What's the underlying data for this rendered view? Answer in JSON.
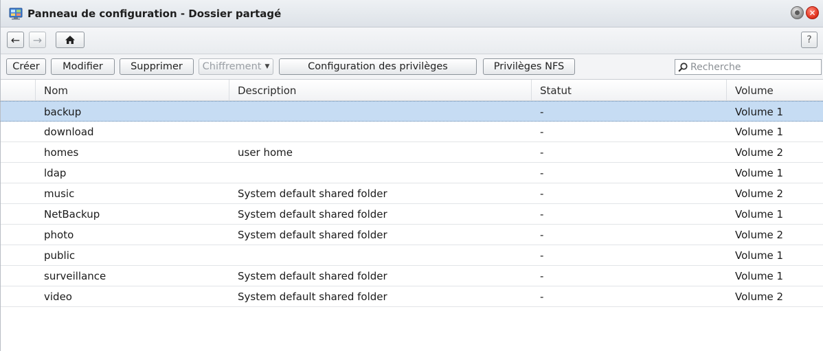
{
  "window": {
    "title": "Panneau de configuration - Dossier partagé"
  },
  "nav": {
    "back": "←",
    "forward": "→",
    "help": "?"
  },
  "toolbar": {
    "create": "Créer",
    "edit": "Modifier",
    "delete": "Supprimer",
    "encryption": "Chiffrement",
    "privileges": "Configuration des privilèges",
    "nfs": "Privilèges NFS",
    "search_placeholder": "Recherche"
  },
  "table": {
    "columns": [
      "Nom",
      "Description",
      "Statut",
      "Volume"
    ],
    "rows": [
      {
        "name": "backup",
        "description": "",
        "status": "-",
        "volume": "Volume 1",
        "selected": true
      },
      {
        "name": "download",
        "description": "",
        "status": "-",
        "volume": "Volume 1"
      },
      {
        "name": "homes",
        "description": "user home",
        "status": "-",
        "volume": "Volume 2"
      },
      {
        "name": "ldap",
        "description": "",
        "status": "-",
        "volume": "Volume 1"
      },
      {
        "name": "music",
        "description": "System default shared folder",
        "status": "-",
        "volume": "Volume 2"
      },
      {
        "name": "NetBackup",
        "description": "System default shared folder",
        "status": "-",
        "volume": "Volume 1"
      },
      {
        "name": "photo",
        "description": "System default shared folder",
        "status": "-",
        "volume": "Volume 2"
      },
      {
        "name": "public",
        "description": "",
        "status": "-",
        "volume": "Volume 1"
      },
      {
        "name": "surveillance",
        "description": "System default shared folder",
        "status": "-",
        "volume": "Volume 1"
      },
      {
        "name": "video",
        "description": "System default shared folder",
        "status": "-",
        "volume": "Volume 2"
      }
    ]
  }
}
